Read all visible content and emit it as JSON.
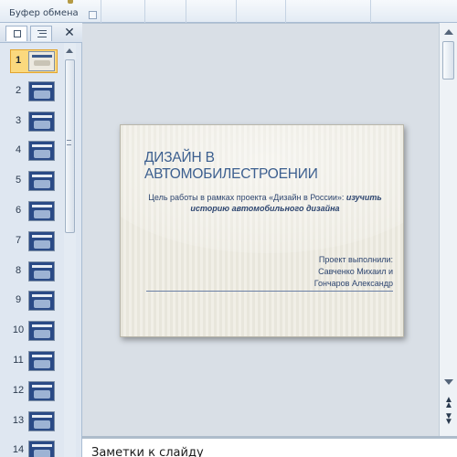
{
  "ribbon": {
    "group_label": "Буфер обмена"
  },
  "slides_pane": {
    "close_label": "✕",
    "thumbnails": [
      {
        "num": "1"
      },
      {
        "num": "2"
      },
      {
        "num": "3"
      },
      {
        "num": "4"
      },
      {
        "num": "5"
      },
      {
        "num": "6"
      },
      {
        "num": "7"
      },
      {
        "num": "8"
      },
      {
        "num": "9"
      },
      {
        "num": "10"
      },
      {
        "num": "11"
      },
      {
        "num": "12"
      },
      {
        "num": "13"
      },
      {
        "num": "14"
      }
    ]
  },
  "slide": {
    "title": "ДИЗАЙН В АВТОМОБИЛЕСТРОЕНИИ",
    "goal_text": "Цель работы в рамках проекта «Дизайн в России»: ",
    "goal_emphasis": "изучить историю автомобильного дизайна",
    "author_label": "Проект выполнили:",
    "author_1": "Савченко Михаил и",
    "author_2": "Гончаров Александр"
  },
  "notes": {
    "placeholder": "Заметки к слайду"
  }
}
